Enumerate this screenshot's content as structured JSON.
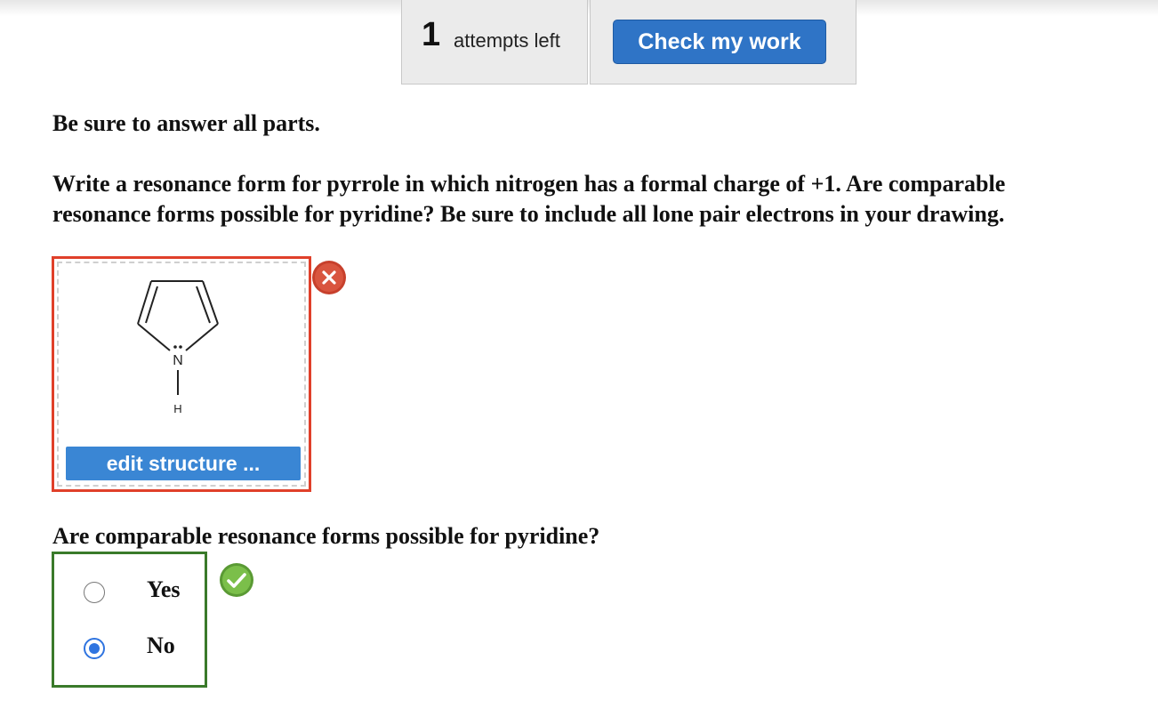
{
  "header": {
    "attempts_count": "1",
    "attempts_label": "attempts left",
    "check_button_label": "Check my work"
  },
  "instructions": "Be sure to answer all parts.",
  "question": {
    "line1": "Write a resonance form for pyrrole in which nitrogen has a formal charge of +1. Are comparable",
    "line2": "resonance forms possible for pyridine? Be sure to include all lone pair electrons in your drawing."
  },
  "drawing": {
    "atom_n_label": "N",
    "atom_h_label": "H",
    "edit_button_label": "edit structure ...",
    "status": "incorrect",
    "status_icon": "close-icon"
  },
  "part2": {
    "question": "Are comparable resonance forms possible for pyridine?",
    "options": [
      {
        "label": "Yes",
        "selected": false
      },
      {
        "label": "No",
        "selected": true
      }
    ],
    "status": "correct",
    "status_icon": "checkmark-icon"
  },
  "colors": {
    "accent_blue": "#2f74c6",
    "incorrect_red": "#e0402a",
    "correct_green": "#3a7a2a"
  }
}
